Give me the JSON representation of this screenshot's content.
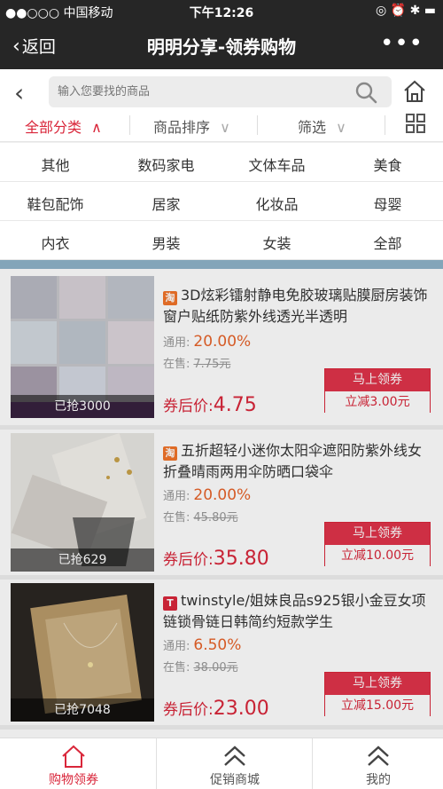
{
  "status": {
    "carrier": "●●○○○ 中国移动",
    "time": "下午12:26",
    "right": "◎ ⏰ ✱ ▬"
  },
  "nav": {
    "back": "返回",
    "title": "明明分享-领券购物",
    "more": "•••"
  },
  "search": {
    "placeholder": "输入您要找的商品"
  },
  "filters": [
    {
      "label": "全部分类",
      "arrow": "∧"
    },
    {
      "label": "商品排序",
      "arrow": "∨"
    },
    {
      "label": "筛选",
      "arrow": "∨"
    }
  ],
  "categories": [
    [
      "其他",
      "数码家电",
      "文体车品",
      "美食"
    ],
    [
      "鞋包配饰",
      "居家",
      "化妆品",
      "母婴"
    ],
    [
      "内衣",
      "男装",
      "女装",
      "全部"
    ]
  ],
  "items": [
    {
      "platform": "淘",
      "title": "3D炫彩镭射静电免胶玻璃贴膜厨房装饰窗户贴纸防紫外线透光半透明",
      "rate_label": "通用:",
      "rate": "20.00%",
      "onsale_label": "在售:",
      "onsale": "7.75元",
      "price_label": "券后价:",
      "price": "4.75",
      "grabbed": "已抢3000",
      "btn_top": "马上领券",
      "btn_bottom": "立减3.00元"
    },
    {
      "platform": "淘",
      "title": "五折超轻小迷你太阳伞遮阳防紫外线女折叠晴雨两用伞防晒口袋伞",
      "rate_label": "通用:",
      "rate": "20.00%",
      "onsale_label": "在售:",
      "onsale": "45.80元",
      "price_label": "券后价:",
      "price": "35.80",
      "grabbed": "已抢629",
      "btn_top": "马上领券",
      "btn_bottom": "立减10.00元"
    },
    {
      "platform": "T",
      "title": "twinstyle/姐妹良品s925银小金豆女项链锁骨链日韩简约短款学生",
      "rate_label": "通用:",
      "rate": "6.50%",
      "onsale_label": "在售:",
      "onsale": "38.00元",
      "price_label": "券后价:",
      "price": "23.00",
      "grabbed": "已抢7048",
      "btn_top": "马上领券",
      "btn_bottom": "立减15.00元"
    }
  ],
  "tabs": [
    {
      "label": "购物领券"
    },
    {
      "label": "促销商城"
    },
    {
      "label": "我的"
    }
  ],
  "colors": {
    "accent": "#d9263a",
    "rate": "#e8632a",
    "taobao": "#f2752a",
    "tmall": "#d9263a"
  }
}
